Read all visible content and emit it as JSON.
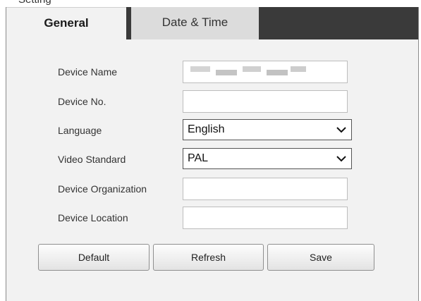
{
  "header": {
    "title": "Setting"
  },
  "tabs": [
    {
      "label": "General",
      "active": true
    },
    {
      "label": "Date & Time",
      "active": false
    }
  ],
  "form": {
    "device_name": {
      "label": "Device Name",
      "value": ""
    },
    "device_no": {
      "label": "Device No.",
      "value": ""
    },
    "language": {
      "label": "Language",
      "value": "English"
    },
    "video_standard": {
      "label": "Video Standard",
      "value": "PAL"
    },
    "device_organization": {
      "label": "Device Organization",
      "value": ""
    },
    "device_location": {
      "label": "Device Location",
      "value": ""
    }
  },
  "buttons": {
    "default_label": "Default",
    "refresh_label": "Refresh",
    "save_label": "Save"
  },
  "colors": {
    "tab_bar": "#3a3a3a",
    "active_tab": "#f2f2f2",
    "inactive_tab": "#dcdcdc",
    "panel_background": "#f2f2f2"
  },
  "icons": {
    "select_arrow": "chevron-down-icon"
  }
}
